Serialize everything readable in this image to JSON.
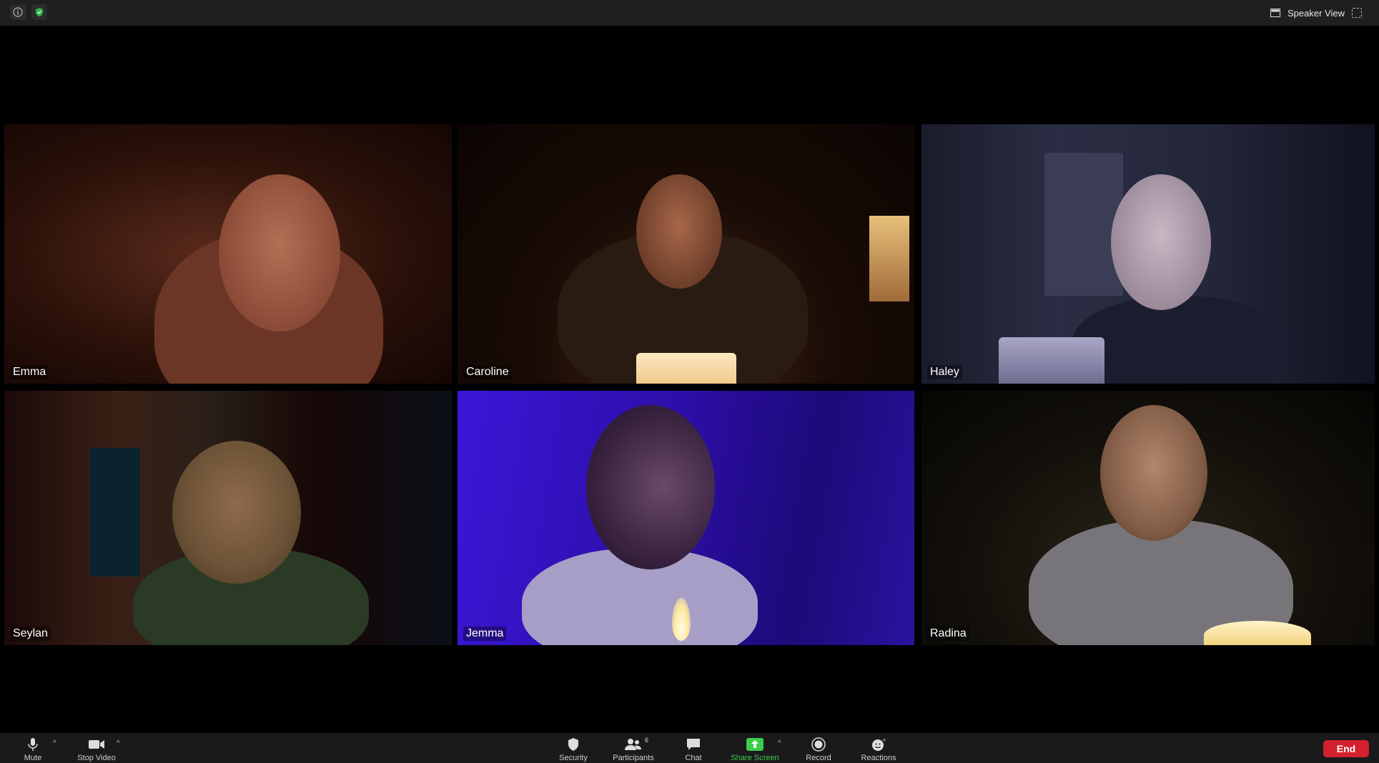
{
  "topbar": {
    "speaker_view_label": "Speaker View"
  },
  "participants": [
    {
      "name": "Emma"
    },
    {
      "name": "Caroline"
    },
    {
      "name": "Haley"
    },
    {
      "name": "Seylan"
    },
    {
      "name": "Jemma"
    },
    {
      "name": "Radina"
    }
  ],
  "toolbar": {
    "mute_label": "Mute",
    "stop_video_label": "Stop Video",
    "security_label": "Security",
    "participants_label": "Participants",
    "participants_count": "6",
    "chat_label": "Chat",
    "share_screen_label": "Share Screen",
    "record_label": "Record",
    "reactions_label": "Reactions",
    "end_label": "End"
  },
  "colors": {
    "share_screen_green": "#3ccd4a",
    "end_red": "#d3202d",
    "shield_green": "#2fb24a"
  }
}
